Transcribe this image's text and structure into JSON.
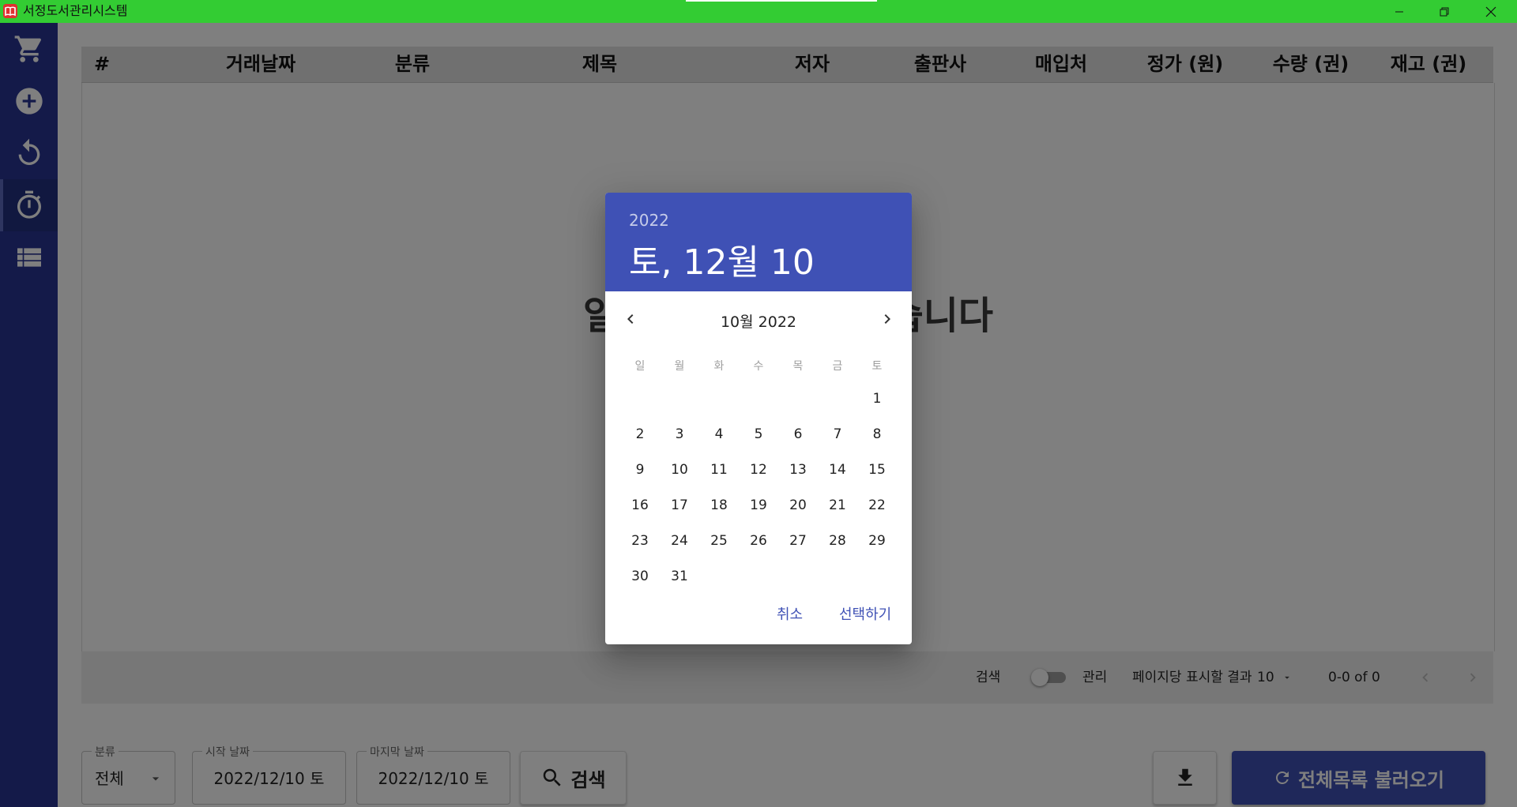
{
  "window": {
    "title": "서정도서관리시스템",
    "app_icon": "book-icon",
    "controls": [
      "minimize-icon",
      "restore-icon",
      "close-icon"
    ]
  },
  "sidebar": {
    "items": [
      {
        "name": "cart",
        "icon": "cart-icon",
        "active": false
      },
      {
        "name": "add",
        "icon": "add-circle-icon",
        "active": false
      },
      {
        "name": "return",
        "icon": "undo-icon",
        "active": false
      },
      {
        "name": "timer",
        "icon": "timer-icon",
        "active": true
      },
      {
        "name": "list",
        "icon": "list-icon",
        "active": false
      }
    ]
  },
  "table": {
    "columns": [
      "#",
      "거래날짜",
      "분류",
      "제목",
      "저자",
      "출판사",
      "매입처",
      "정가 (원)",
      "수량 (권)",
      "재고 (권)"
    ],
    "empty_message": "일치하는 결과가 없습니다"
  },
  "footer": {
    "toggle_left": "검색",
    "toggle_right": "관리",
    "toggle_on": false,
    "rows_per_page_label": "페이지당 표시할 결과",
    "rows_per_page": "10",
    "pagination": "0-0 of 0"
  },
  "filters": {
    "category": {
      "label": "분류",
      "value": "전체"
    },
    "start_date": {
      "label": "시작 날짜",
      "value": "2022/12/10 토"
    },
    "end_date": {
      "label": "마지막 날짜",
      "value": "2022/12/10 토"
    },
    "search_button": "검색",
    "download_icon": "download-icon",
    "reload_button": "전체목록 불러오기"
  },
  "datepicker": {
    "year": "2022",
    "selected_date": "토, 12월 10",
    "month_label": "10월 2022",
    "weekdays": [
      "일",
      "월",
      "화",
      "수",
      "목",
      "금",
      "토"
    ],
    "first_weekday_index": 6,
    "days": [
      "1",
      "2",
      "3",
      "4",
      "5",
      "6",
      "7",
      "8",
      "9",
      "10",
      "11",
      "12",
      "13",
      "14",
      "15",
      "16",
      "17",
      "18",
      "19",
      "20",
      "21",
      "22",
      "23",
      "24",
      "25",
      "26",
      "27",
      "28",
      "29",
      "30",
      "31"
    ],
    "cancel_label": "취소",
    "ok_label": "선택하기"
  },
  "colors": {
    "titlebar": "#33cc33",
    "sidebar": "#283593",
    "primary": "#3f51b5",
    "overlay": "rgba(0,0,0,0.5)"
  }
}
